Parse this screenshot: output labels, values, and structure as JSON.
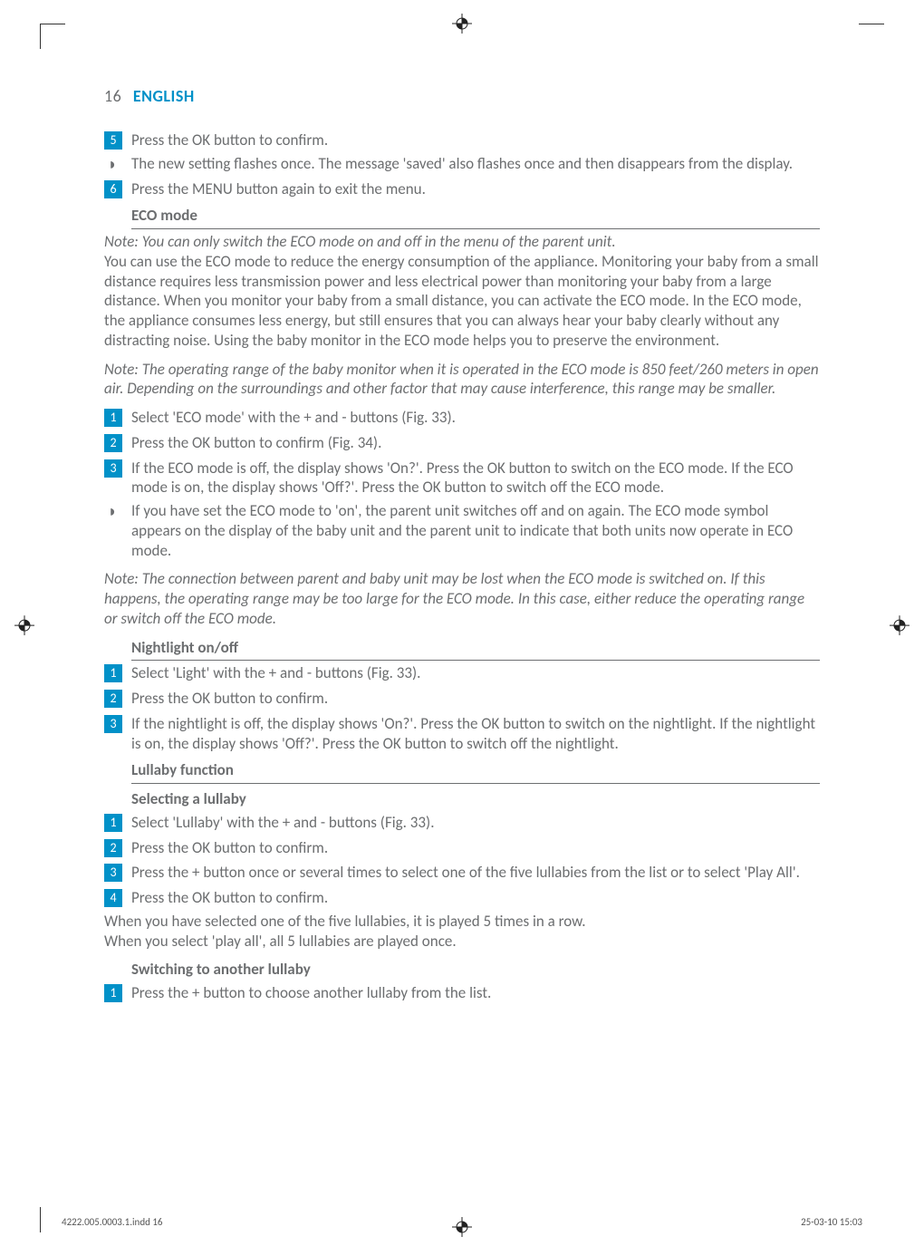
{
  "page_number": "16",
  "lang_label": "ENGLISH",
  "step5": "Press the OK button to confirm.",
  "step5_bullet": "The new setting flashes once. The message 'saved' also flashes once and then disappears from the display.",
  "step6": "Press the MENU button again to exit the menu.",
  "eco": {
    "heading": "ECO mode",
    "note1": "Note: You can only switch the ECO mode on and off in the menu of the parent unit.",
    "para1": "You can use the ECO mode to reduce the energy consumption of the appliance. Monitoring your baby from a small distance requires less transmission power and less electrical power than monitoring your baby from a large distance. When you monitor your baby from a small distance, you can activate the ECO mode. In the ECO mode, the appliance consumes less energy, but still ensures that you can always hear your baby clearly without any distracting noise. Using the baby monitor in the ECO mode helps you to preserve the environment.",
    "note2": "Note: The operating range of the baby monitor when it is operated in the ECO mode is 850 feet/260 meters in open air. Depending on the surroundings and other factor that may cause interference, this range may be smaller.",
    "s1": "Select 'ECO mode' with the + and - buttons (Fig. 33).",
    "s2": "Press the OK button to confirm (Fig. 34).",
    "s3": "If the ECO mode is off, the display shows 'On?'. Press the OK button to switch on the ECO mode. If the ECO mode is on, the display shows 'Off?'. Press the OK button to switch off the ECO mode.",
    "s3_bullet": "If you have set the ECO mode to 'on', the parent unit switches off and on again. The ECO mode symbol appears on the display of the baby unit and the parent unit to indicate that both units now operate in ECO mode.",
    "note3": "Note: The connection between parent and baby unit may be lost when the ECO mode is switched on. If this happens, the operating range may be too large for the ECO mode. In this case, either reduce the operating range or switch off the ECO mode."
  },
  "night": {
    "heading": "Nightlight on/off",
    "s1": "Select 'Light' with the + and - buttons (Fig. 33).",
    "s2": "Press the OK button to confirm.",
    "s3": "If the nightlight is off, the display shows 'On?'. Press the OK button to switch on the nightlight. If the nightlight is on, the display shows 'Off?'. Press the OK button to switch off the nightlight."
  },
  "lullaby": {
    "heading": "Lullaby function",
    "sub1": "Selecting a lullaby",
    "s1": "Select 'Lullaby' with the + and - buttons (Fig. 33).",
    "s2": "Press the OK button to confirm.",
    "s3": "Press the + button once or several times to select one of the five lullabies from the list or to select 'Play All'.",
    "s4": "Press the OK button to confirm.",
    "para1": "When you have selected one of the five lullabies, it is played 5 times in a row.",
    "para2": "When you select 'play all', all 5 lullabies are played once.",
    "sub2": "Switching to another lullaby",
    "sw1": "Press the + button to choose another lullaby from the list."
  },
  "footer": {
    "left": "4222.005.0003.1.indd   16",
    "right": "25-03-10   15:03"
  }
}
